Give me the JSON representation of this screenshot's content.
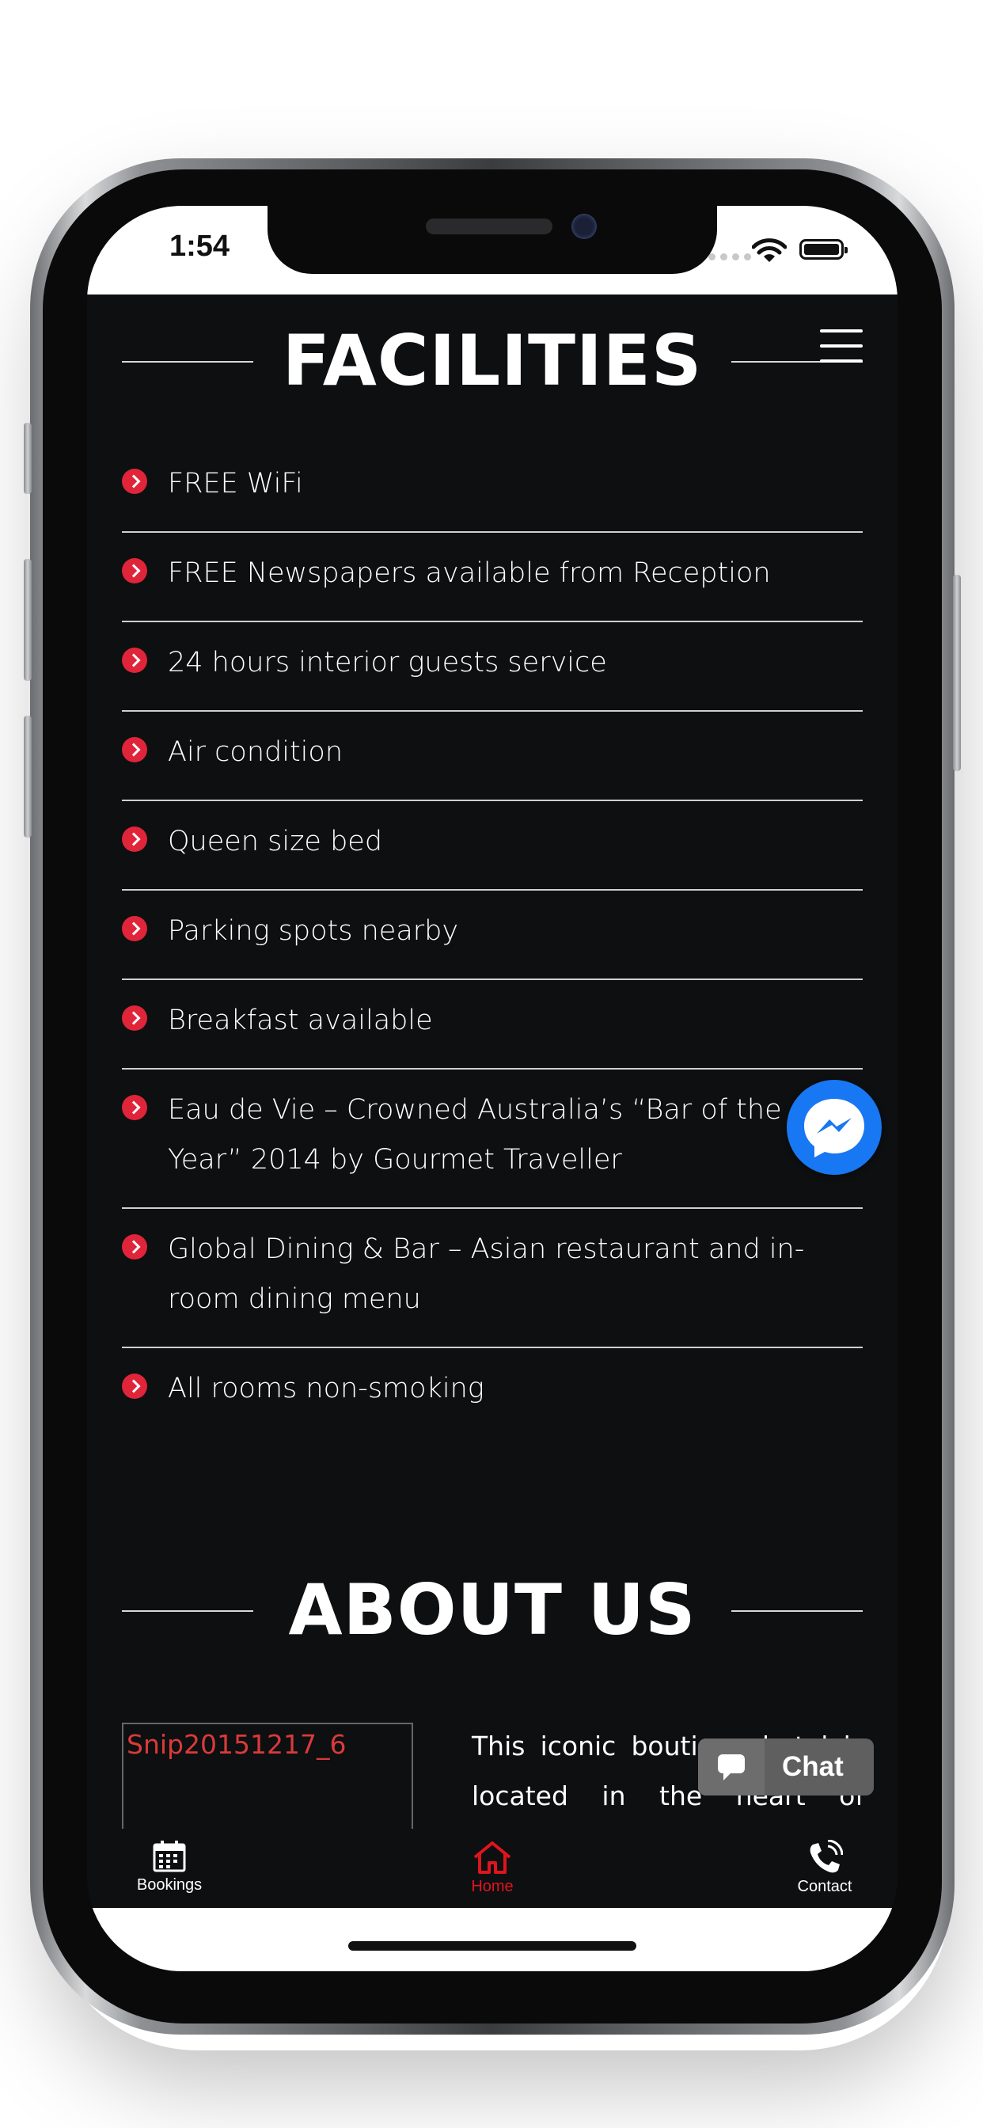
{
  "status_bar": {
    "time": "1:54"
  },
  "facilities": {
    "title": "FACILITIES",
    "items": [
      {
        "text": "FREE WiFi"
      },
      {
        "text": "FREE Newspapers available from Reception"
      },
      {
        "text": "24 hours interior guests service"
      },
      {
        "text": "Air condition"
      },
      {
        "text": "Queen size bed"
      },
      {
        "text": "Parking spots nearby"
      },
      {
        "text": "Breakfast available"
      },
      {
        "text": "Eau de Vie – Crowned Australia’s “Bar of the Year” 2014 by Gourmet Traveller"
      },
      {
        "text": "Global Dining & Bar – Asian restaurant and in-room dining menu"
      },
      {
        "text": "All rooms non-smoking"
      }
    ]
  },
  "about": {
    "title": "ABOUT US",
    "image_alt": "Snip20151217_6",
    "text": "This iconic boutique hotel is located in the heart of Sydney’s"
  },
  "chat_widget": {
    "label": "Chat"
  },
  "bottom_nav": {
    "items": [
      {
        "label": "Bookings",
        "icon": "calendar-icon"
      },
      {
        "label": "Home",
        "icon": "home-icon",
        "active": true
      },
      {
        "label": "Contact",
        "icon": "phone-icon"
      }
    ]
  },
  "colors": {
    "accent": "#e0243a",
    "background": "#0d0f10",
    "nav_active": "#e0141e",
    "messenger": "#1877f2"
  }
}
